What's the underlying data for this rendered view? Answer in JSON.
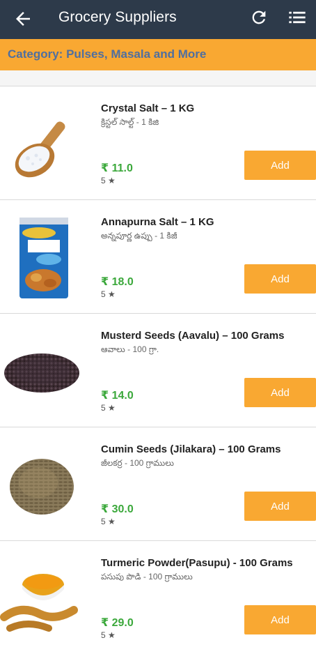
{
  "appbar": {
    "title": "Grocery Suppliers",
    "back_icon": "arrow-left-icon",
    "refresh_icon": "refresh-icon",
    "menu_icon": "list-menu-icon"
  },
  "category": {
    "label": "Category: Pulses, Masala and More"
  },
  "colors": {
    "appbar": "#2d3a4a",
    "accent": "#f9a832",
    "category_text": "#4f6fa0",
    "price": "#3ba83b"
  },
  "products": [
    {
      "name": "Crystal Salt – 1 KG",
      "local_name": "క్రిస్టల్ సాల్ట్ - 1 కిజి",
      "price": "₹ 11.0",
      "rating": "5 ★",
      "add_label": "Add",
      "image": "salt-scoop"
    },
    {
      "name": "Annapurna Salt – 1 KG",
      "local_name": "అన్నపూర్ణ ఉప్పు - 1 కిజీ",
      "price": "₹ 18.0",
      "rating": "5 ★",
      "add_label": "Add",
      "image": "salt-packet"
    },
    {
      "name": "Musterd Seeds (Aavalu) – 100 Grams",
      "local_name": "ఆవాలు - 100 గ్రా.",
      "price": "₹ 14.0",
      "rating": "5 ★",
      "add_label": "Add",
      "image": "mustard-seeds"
    },
    {
      "name": "Cumin Seeds (Jilakara) – 100 Grams",
      "local_name": "జీలకర్ర - 100 గ్రాములు",
      "price": "₹ 30.0",
      "rating": "5 ★",
      "add_label": "Add",
      "image": "cumin-seeds"
    },
    {
      "name": "Turmeric Powder(Pasupu) -  100 Grams",
      "local_name": "పసుపు పొడి - 100 గ్రాములు",
      "price": "₹ 29.0",
      "rating": "5 ★",
      "add_label": "Add",
      "image": "turmeric"
    }
  ]
}
